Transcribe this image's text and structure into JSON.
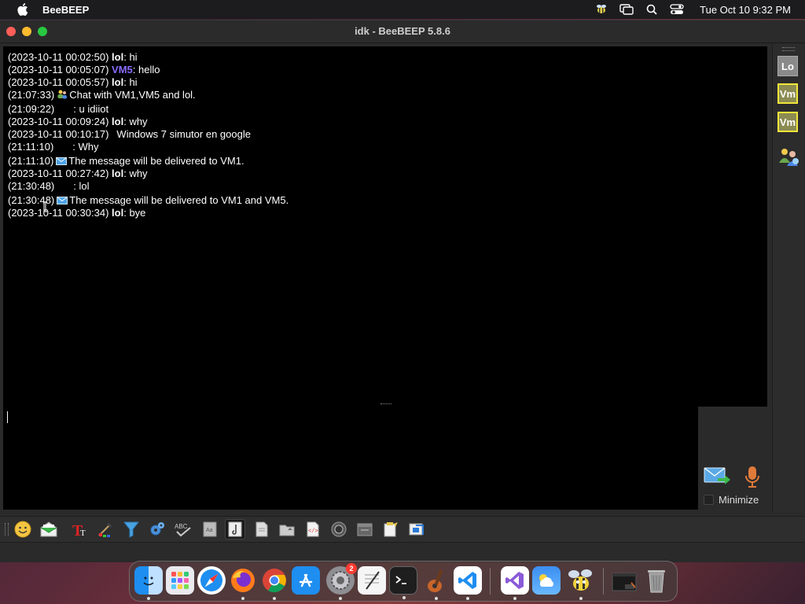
{
  "menubar": {
    "app_name": "BeeBEEP",
    "clock": "Tue Oct 10  9:32 PM"
  },
  "window": {
    "title": "idk - BeeBEEP 5.8.6"
  },
  "chat": {
    "messages": [
      {
        "ts": "(2023-10-11 00:02:50)",
        "nick": "lol",
        "text": ": hi"
      },
      {
        "ts": "(2023-10-11 00:05:07)",
        "nick": "VM5",
        "text": ": hello"
      },
      {
        "ts": "(2023-10-11 00:05:57)",
        "nick": "lol",
        "text": ": hi"
      },
      {
        "ts": "(21:07:33)",
        "icon": "users-icon",
        "text": "Chat with VM1,VM5 and lol."
      },
      {
        "ts": "(21:09:22)",
        "text": ": u idiiot"
      },
      {
        "ts": "(2023-10-11 00:09:24)",
        "nick": "lol",
        "text": ": why"
      },
      {
        "ts": "(2023-10-11 00:10:17)",
        "text": "Windows 7 simutor en google"
      },
      {
        "ts": "(21:11:10)",
        "text": ": Why"
      },
      {
        "ts": "(21:11:10)",
        "icon": "envelope-icon",
        "text": "The message will be delivered to VM1."
      },
      {
        "ts": "(2023-10-11 00:27:42)",
        "nick": "lol",
        "text": ": why"
      },
      {
        "ts": "(21:30:48)",
        "text": ": lol"
      },
      {
        "ts": "(21:30:48)",
        "icon": "envelope-icon",
        "text": "The message will be delivered to VM1 and VM5."
      },
      {
        "ts": "(2023-10-11 00:30:34)",
        "nick": "lol",
        "text": ": bye"
      }
    ]
  },
  "compose": {
    "minimize_label": "Minimize"
  },
  "sidebar": {
    "users": [
      {
        "label": "Lo"
      },
      {
        "label": "Vm"
      },
      {
        "label": "Vm"
      }
    ]
  },
  "toolbar": {
    "buttons": [
      "emoji-icon",
      "envelope-open-icon",
      "font-icon",
      "color-icon",
      "filter-icon",
      "settings-icon",
      "spellcheck-icon",
      "dictionary-icon",
      "note-icon",
      "file-icon",
      "folder-icon",
      "code-icon",
      "screenshot-icon",
      "history-icon",
      "clipboard-icon",
      "share-icon"
    ]
  },
  "dock": {
    "badge_settings": "2",
    "apps": [
      "finder",
      "launchpad",
      "safari",
      "firefox",
      "chrome",
      "app-store",
      "system-settings",
      "textedit",
      "terminal",
      "garageband",
      "vscode",
      "visual-studio",
      "weather",
      "beebeep",
      "screenshot",
      "trash"
    ]
  },
  "colors": {
    "vm_nick": "#8a6cff",
    "avatar_border": "#f0e63a"
  }
}
